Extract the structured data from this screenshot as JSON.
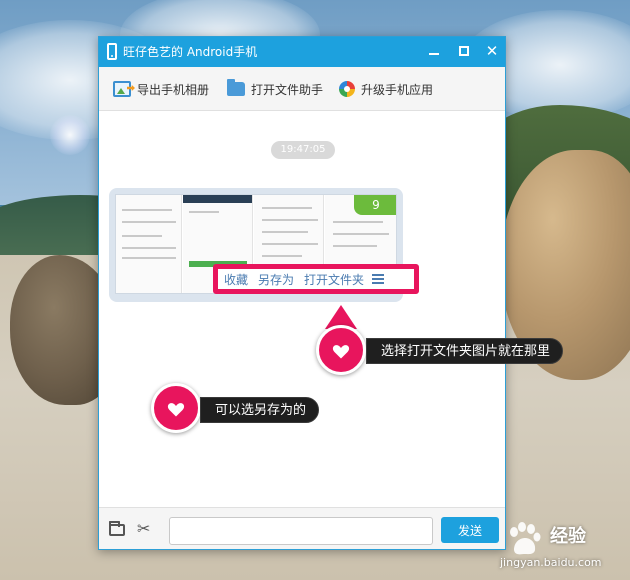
{
  "window": {
    "title": "旺仔色艺的 Android手机",
    "accent_color": "#1da1de",
    "controls": {
      "close_glyph": "✕"
    }
  },
  "toolbar": {
    "export_photos": "导出手机相册",
    "open_file_helper": "打开文件助手",
    "upgrade_apps": "升级手机应用"
  },
  "chat": {
    "timestamp": "19:47:05",
    "image_message": {
      "badge_count": "9",
      "actions": {
        "favorite": "收藏",
        "save_as": "另存为",
        "open_folder": "打开文件夹"
      }
    }
  },
  "input_bar": {
    "send_label": "发送",
    "message_value": ""
  },
  "annotations": {
    "highlight_color": "#e8155d",
    "tip_open_folder": "选择打开文件夹图片就在那里",
    "tip_save_as": "可以选另存为的"
  },
  "watermark": {
    "brand": "经验",
    "url": "jingyan.baidu.com"
  }
}
